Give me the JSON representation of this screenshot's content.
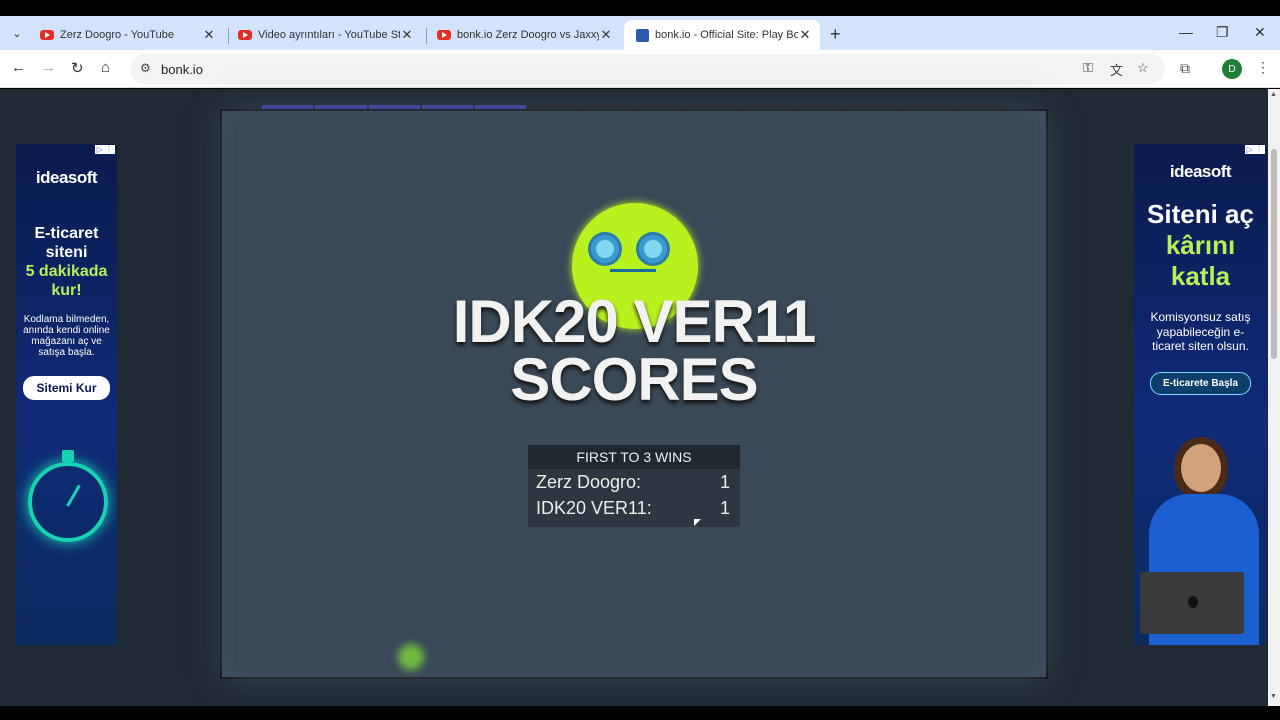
{
  "browser": {
    "tabs": [
      {
        "title": "Zerz Doogro - YouTube",
        "type": "youtube"
      },
      {
        "title": "Video ayrıntıları - YouTube Stud",
        "type": "youtube"
      },
      {
        "title": "bonk.io Zerz Doogro vs Jaxxygu",
        "type": "youtube"
      },
      {
        "title": "bonk.io - Official Site: Play Bonk",
        "type": "bonk"
      }
    ],
    "url": "bonk.io",
    "profile_initial": "D"
  },
  "game": {
    "title_line1": "IDK20 VER11",
    "title_line2": "SCORES",
    "scoreboard": {
      "header": "FIRST TO 3 WINS",
      "rows": [
        {
          "name": "Zerz Doogro:",
          "score": "1"
        },
        {
          "name": "IDK20 VER11:",
          "score": "1"
        }
      ]
    },
    "progress_rounds_total": 14,
    "progress_rounds_filled": 5,
    "accent": "#b8f21e"
  },
  "ads": {
    "left": {
      "badge": "▷ ⋮",
      "logo": "ideasoft",
      "headline": "E-ticaret siteni",
      "headline_accent": "5 dakikada kur!",
      "body": "Kodlama bilmeden, anında kendi online mağazanı aç ve satışa başla.",
      "button": "Sitemi Kur"
    },
    "right": {
      "badge": "▷ ⋮",
      "logo": "ideasoft",
      "headline": "Siteni aç",
      "headline_accent": "kârını katla",
      "body": "Komisyonsuz satış yapabileceğin e-ticaret siten olsun.",
      "button": "E-ticarete Başla"
    }
  }
}
